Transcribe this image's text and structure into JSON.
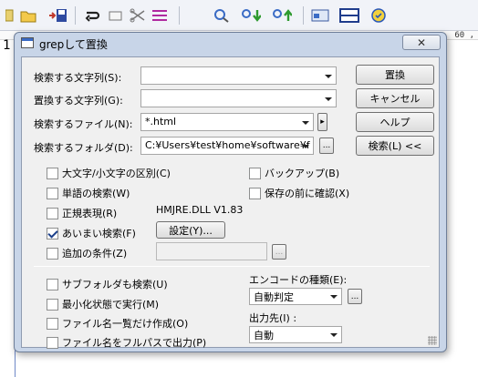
{
  "editor": {
    "line_number": "1",
    "ruler_label": "60 ,"
  },
  "dialog": {
    "title": "grepして置換",
    "close_symbol": "✕",
    "labels": {
      "search_text": "検索する文字列(S):",
      "replace_text": "置換する文字列(G):",
      "search_file": "検索するファイル(N):",
      "search_folder": "検索するフォルダ(D):",
      "encoding": "エンコードの種類(E):",
      "output": "出力先(I) :",
      "dll_version": "HMJRE.DLL  V1.83"
    },
    "fields": {
      "search_text_value": "",
      "replace_text_value": "",
      "file_value": "*.html",
      "folder_value": "C:¥Users¥test¥home¥software¥f",
      "encoding_value": "自動判定",
      "output_value": "自動",
      "additional_condition_value": ""
    },
    "buttons": {
      "replace": "置換",
      "cancel": "キャンセル",
      "help": "ヘルプ",
      "search": "検索(L) <<",
      "settings": "設定(Y)...",
      "browse": "...",
      "file_arrow": "▸"
    },
    "checkboxes": {
      "case_sensitive": {
        "label": "大文字/小文字の区別(C)",
        "checked": false
      },
      "word_search": {
        "label": "単語の検索(W)",
        "checked": false
      },
      "regex": {
        "label": "正規表現(R)",
        "checked": false
      },
      "fuzzy": {
        "label": "あいまい検索(F)",
        "checked": true
      },
      "additional": {
        "label": "追加の条件(Z)",
        "checked": false
      },
      "backup": {
        "label": "バックアップ(B)",
        "checked": false
      },
      "confirm_before_save": {
        "label": "保存の前に確認(X)",
        "checked": false
      },
      "subfolders": {
        "label": "サブフォルダも検索(U)",
        "checked": false
      },
      "minimized": {
        "label": "最小化状態で実行(M)",
        "checked": false
      },
      "filename_list": {
        "label": "ファイル名一覧だけ作成(O)",
        "checked": false
      },
      "fullpath": {
        "label": "ファイル名をフルパスで出力(P)",
        "checked": false
      }
    }
  },
  "toolbar_icons": [
    "open-folder-icon",
    "save-icon",
    "wrap-icon",
    "copy-icon",
    "cut-icon",
    "list-icon",
    "search-icon",
    "search-next-icon",
    "search-prev-icon",
    "window-icon",
    "split-icon",
    "macro-icon"
  ],
  "colors": {
    "dialog_frame": "#c8d5e8",
    "client": "#f0f0f0",
    "check_mark": "#1b3f8a"
  }
}
